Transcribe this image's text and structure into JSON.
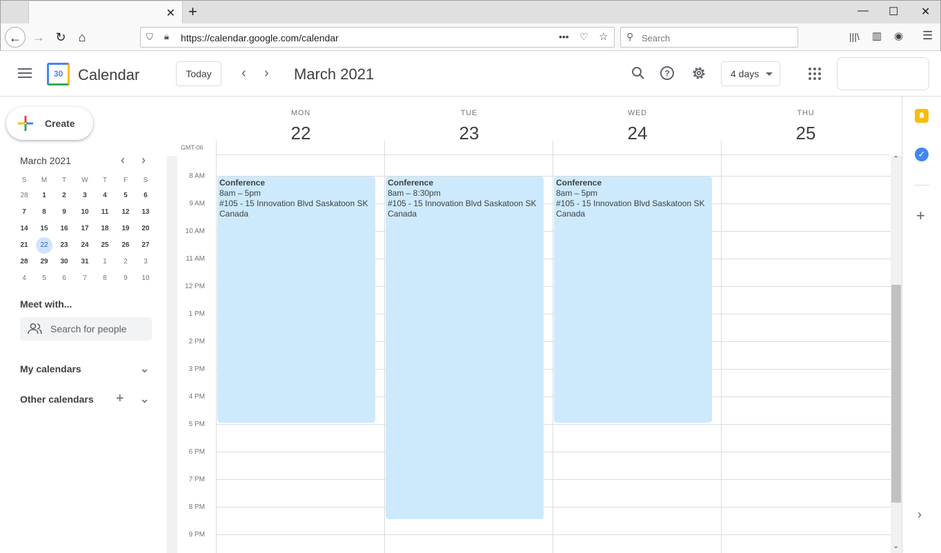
{
  "browser": {
    "url": "https://calendar.google.com/calendar",
    "search_placeholder": "Search"
  },
  "header": {
    "app_name": "Calendar",
    "logo_text": "30",
    "today_label": "Today",
    "date_title": "March 2021",
    "view_label": "4 days"
  },
  "sidebar": {
    "create_label": "Create",
    "mini_title": "March 2021",
    "weekday_headers": [
      "S",
      "M",
      "T",
      "W",
      "T",
      "F",
      "S"
    ],
    "weeks": [
      [
        "28",
        "1",
        "2",
        "3",
        "4",
        "5",
        "6"
      ],
      [
        "7",
        "8",
        "9",
        "10",
        "11",
        "12",
        "13"
      ],
      [
        "14",
        "15",
        "16",
        "17",
        "18",
        "19",
        "20"
      ],
      [
        "21",
        "22",
        "23",
        "24",
        "25",
        "26",
        "27"
      ],
      [
        "28",
        "29",
        "30",
        "31",
        "1",
        "2",
        "3"
      ],
      [
        "4",
        "5",
        "6",
        "7",
        "8",
        "9",
        "10"
      ]
    ],
    "meet_title": "Meet with...",
    "people_placeholder": "Search for people",
    "my_calendars": "My calendars",
    "other_calendars": "Other calendars"
  },
  "columns": [
    {
      "dow": "MON",
      "day": "22"
    },
    {
      "dow": "TUE",
      "day": "23"
    },
    {
      "dow": "WED",
      "day": "24"
    },
    {
      "dow": "THU",
      "day": "25"
    }
  ],
  "timezone": "GMT-06",
  "time_labels": [
    "8 AM",
    "9 AM",
    "10 AM",
    "11 AM",
    "12 PM",
    "1 PM",
    "2 PM",
    "3 PM",
    "4 PM",
    "5 PM",
    "6 PM",
    "7 PM",
    "8 PM",
    "9 PM"
  ],
  "events": [
    {
      "title": "Conference",
      "time": "8am – 5pm",
      "location": "#105 - 15 Innovation Blvd Saskatoon SK Canada"
    },
    {
      "title": "Conference",
      "time": "8am – 8:30pm",
      "location": "#105 - 15 Innovation Blvd Saskatoon SK Canada"
    },
    {
      "title": "Conference",
      "time": "8am – 5pm",
      "location": "#105 - 15 Innovation Blvd Saskatoon SK Canada"
    }
  ]
}
